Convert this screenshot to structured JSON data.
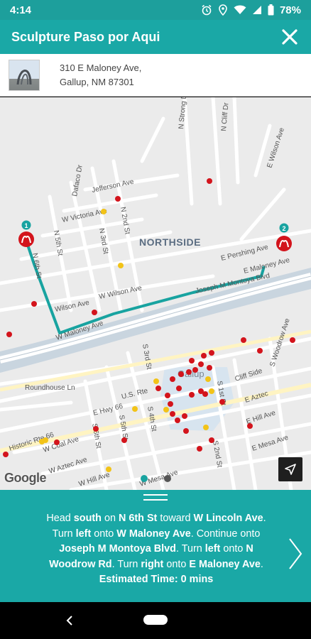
{
  "status_bar": {
    "time": "4:14",
    "battery": "78%",
    "icons": [
      "alarm-icon",
      "location-icon",
      "wifi-icon",
      "signal-icon",
      "battery-icon"
    ]
  },
  "header": {
    "title": "Sculpture Paso por Aqui",
    "close_icon": "close-icon",
    "background": "#1aa8a6"
  },
  "place": {
    "address_line1": "310 E Maloney Ave,",
    "address_line2": "Gallup, NM 87301"
  },
  "map": {
    "labels": {
      "neighborhood": "NORTHSIDE",
      "city": "Gallup",
      "streets": [
        "N Strong Dr",
        "N Cliff Dr",
        "E Wilson Ave",
        "Dafaco Dr",
        "Jefferson Ave",
        "W Victoria Ave",
        "N 2nd St",
        "N 3rd St",
        "N 5th St",
        "W Wilson Ave",
        "Wilson Ave",
        "W Maloney Ave",
        "E Pershing Ave",
        "E Maloney Ave",
        "Joseph M Montoya Blvd",
        "S 3rd St",
        "S 4th St",
        "S 5th St",
        "S 1st St",
        "S 2nd St",
        "S 6th St",
        "U.S. Rte 66",
        "E Hwy 66",
        "Roundhouse Ln",
        "Cliff Side",
        "E Aztec",
        "E Hill Ave",
        "E Mesa Ave",
        "S Woodrow Ave",
        "Historic Rte 66",
        "W Coal Ave",
        "W Aztec Ave",
        "W Hill Ave",
        "W Mesa Ave"
      ]
    },
    "markers": [
      {
        "number": "1",
        "icon": "sculpture-icon"
      },
      {
        "number": "2",
        "icon": "sculpture-icon"
      }
    ],
    "attribution": "Google",
    "route_color": "#1aa8a6",
    "poi_red": "#d3141c",
    "poi_yellow": "#f2c318"
  },
  "directions": {
    "t1": "Head ",
    "b1": "south",
    "t2": " on ",
    "b2": "N 6th St",
    "t3": " toward ",
    "b3": "W Lincoln Ave",
    "t4": ". Turn ",
    "b4": "left",
    "t5": " onto ",
    "b5": "W Maloney Ave",
    "t6": ". Continue onto ",
    "b6": "Joseph M Montoya Blvd",
    "t7": ". Turn ",
    "b7": "left",
    "t8": " onto ",
    "b8": "N Woodrow Rd",
    "t9": ". Turn ",
    "b9": "right",
    "t10": " onto ",
    "b10": "E Maloney Ave",
    "t11": ". ",
    "b11": "Estimated Time: 0 mins"
  },
  "pager": {
    "dots": 2,
    "active": 0
  }
}
